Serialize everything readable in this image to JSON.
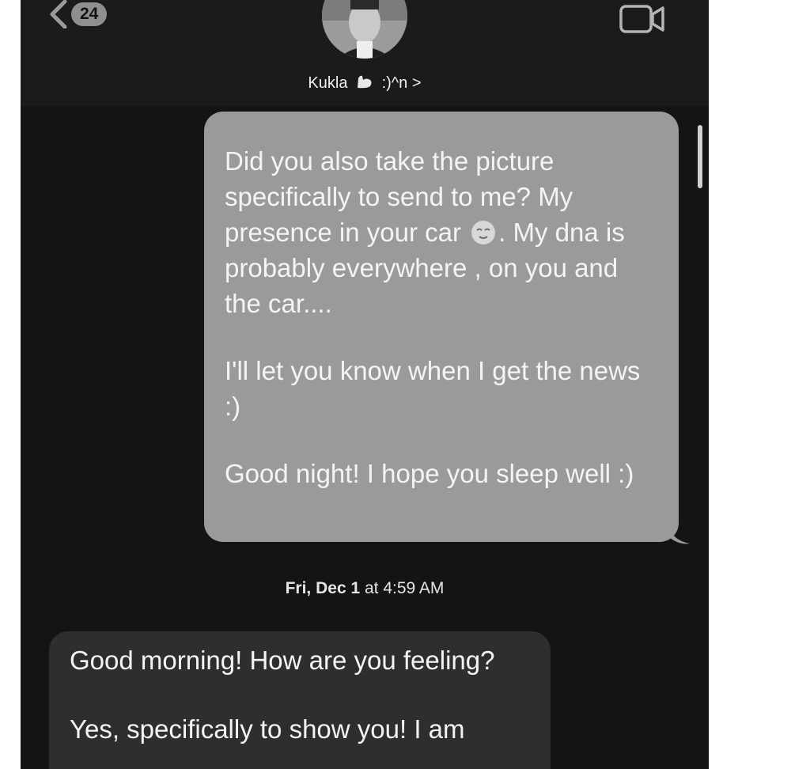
{
  "header": {
    "back_badge": "24",
    "contact_name": "Kukla",
    "contact_suffix": ":)^n",
    "contact_chevron": ">",
    "icons": {
      "back": "chevron-left-icon",
      "video": "video-camera-icon",
      "arm": "flexed-biceps-icon"
    }
  },
  "messages": {
    "outgoing": {
      "para1_a": "Did you also take the picture specifically to send to me? My presence in your car",
      "para1_emoji": "relieved-face-icon",
      "para1_b": ". My dna is probably everywhere , on you and the car....",
      "para2": "I'll let you know when I get the news :)",
      "para3": "Good night! I hope you sleep well :)"
    },
    "timestamp": {
      "day": "Fri, Dec 1",
      "time": "at 4:59 AM"
    },
    "incoming": {
      "para1": "Good morning! How are you feeling?",
      "para2": "Yes, specifically to show you! I am"
    }
  },
  "colors": {
    "background": "#141414",
    "header": "#1b1b1b",
    "outgoing_bubble": "#9a9a9a",
    "incoming_bubble": "#2e2e2e",
    "text": "#f4f4f4"
  }
}
